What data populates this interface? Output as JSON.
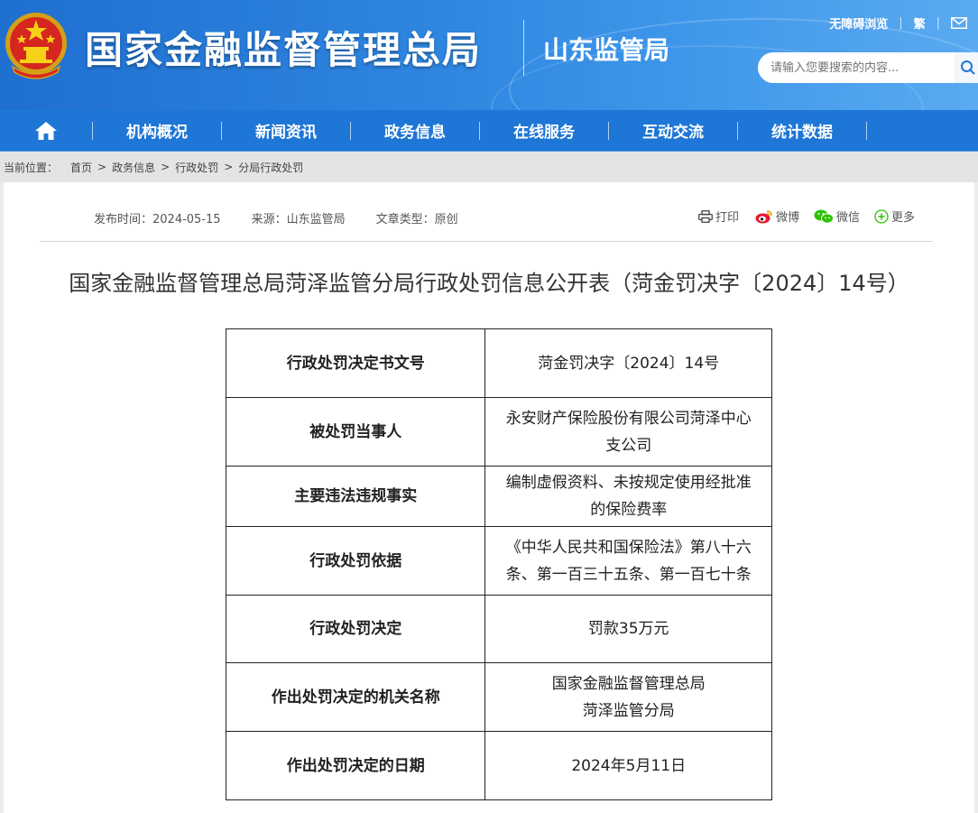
{
  "header": {
    "site_title": "国家金融监督管理总局",
    "sub_title": "山东监管局",
    "accessibility": "无障碍浏览",
    "traditional": "繁",
    "search_placeholder": "请输入您要搜索的内容..."
  },
  "nav": {
    "items": [
      {
        "label": "机构概况"
      },
      {
        "label": "新闻资讯"
      },
      {
        "label": "政务信息"
      },
      {
        "label": "在线服务"
      },
      {
        "label": "互动交流"
      },
      {
        "label": "统计数据"
      }
    ]
  },
  "breadcrumb": {
    "label": "当前位置：",
    "items": [
      "首页",
      "政务信息",
      "行政处罚",
      "分局行政处罚"
    ],
    "sep": ">"
  },
  "meta": {
    "publish": "发布时间：2024-05-15",
    "source": "来源：山东监管局",
    "type": "文章类型：原创"
  },
  "share": {
    "print": "打印",
    "weibo": "微博",
    "wechat": "微信",
    "more": "更多"
  },
  "article": {
    "title": "国家金融监督管理总局菏泽监管分局行政处罚信息公开表（菏金罚决字〔2024〕14号）"
  },
  "table": {
    "rows": [
      {
        "key": "行政处罚决定书文号",
        "value": "菏金罚决字〔2024〕14号"
      },
      {
        "key": "被处罚当事人",
        "value_lines": [
          "永安财产保险股份有限公司菏泽中心",
          "支公司"
        ]
      },
      {
        "key": "主要违法违规事实",
        "value_lines": [
          "编制虚假资料、未按规定使用经批准",
          "的保险费率"
        ]
      },
      {
        "key": "行政处罚依据",
        "value_lines": [
          "《中华人民共和国保险法》第八十六",
          "条、第一百三十五条、第一百七十条"
        ]
      },
      {
        "key": "行政处罚决定",
        "value": "罚款35万元"
      },
      {
        "key": "作出处罚决定的机关名称",
        "value_lines": [
          "国家金融监督管理总局",
          "菏泽监管分局"
        ]
      },
      {
        "key": "作出处罚决定的日期",
        "value": "2024年5月11日"
      }
    ]
  },
  "colors": {
    "header_blue": "#1f6fd0",
    "nav_blue": "#1e76d6",
    "weibo_red": "#e6162d",
    "wechat_green": "#2dc100"
  }
}
